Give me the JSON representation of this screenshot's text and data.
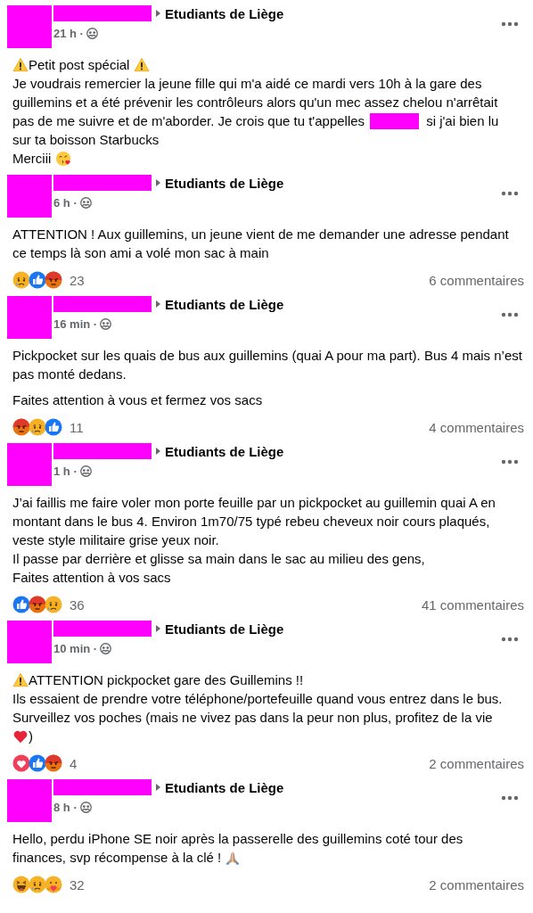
{
  "posts": [
    {
      "group": "Etudiants de Liège",
      "time": "21 h ·",
      "body": [
        [
          [
            {
              "kind": "warning"
            },
            {
              "kind": "text",
              "text": "Petit post spécial "
            },
            {
              "kind": "warning"
            }
          ],
          [
            {
              "kind": "text",
              "text": "Je voudrais remercier la jeune fille qui m'a aidé ce mardi vers 10h à la gare des"
            }
          ],
          [
            {
              "kind": "text",
              "text": "guillemins et a été prévenir les contrôleurs alors qu'un mec assez chelou n'arrêtait"
            }
          ],
          [
            {
              "kind": "text",
              "text": "pas de me suivre et de m'aborder. Je crois que tu t'appelles"
            },
            {
              "kind": "redaction"
            },
            {
              "kind": "text",
              "text": "si j'ai bien lu"
            }
          ],
          [
            {
              "kind": "text",
              "text": "sur ta boisson Starbucks"
            }
          ],
          [
            {
              "kind": "text",
              "text": "Merciii "
            },
            {
              "kind": "kiss"
            }
          ]
        ]
      ]
    },
    {
      "group": "Etudiants de Liège",
      "time": "6 h ·",
      "body": [
        [
          [
            {
              "kind": "text",
              "text": "ATTENTION ! Aux guillemins, un jeune vient de me demander une adresse pendant ce temps là son ami a volé mon sac à main"
            }
          ]
        ]
      ],
      "reactions": [
        {
          "kind": "sad"
        },
        {
          "kind": "like"
        },
        {
          "kind": "angry"
        }
      ],
      "count": "23",
      "comments": "6 commentaires"
    },
    {
      "group": "Etudiants de Liège",
      "time": "16 min ·",
      "body": [
        [
          [
            {
              "kind": "text",
              "text": "Pickpocket sur les quais de bus aux guillemins (quai A pour ma part). Bus 4 mais n’est pas monté dedans."
            }
          ]
        ],
        [
          [
            {
              "kind": "text",
              "text": "Faites attention à vous et fermez vos sacs"
            }
          ]
        ]
      ],
      "reactions": [
        {
          "kind": "angry"
        },
        {
          "kind": "sad"
        },
        {
          "kind": "like"
        }
      ],
      "count": "11",
      "comments": "4 commentaires"
    },
    {
      "group": "Etudiants de Liège",
      "time": "1 h ·",
      "body": [
        [
          [
            {
              "kind": "text",
              "text": "J’ai faillis me faire voler mon porte feuille par un pickpocket au guillemin quai A en montant dans le bus 4. Environ 1m70/75 typé rebeu cheveux noir cours plaqués, veste style militaire grise yeux noir."
            }
          ],
          [
            {
              "kind": "text",
              "text": "Il passe par derrière et glisse sa main dans le sac au milieu des gens,"
            }
          ],
          [
            {
              "kind": "text",
              "text": "Faites attention à vos sacs"
            }
          ]
        ]
      ],
      "reactions": [
        {
          "kind": "like"
        },
        {
          "kind": "angry"
        },
        {
          "kind": "sad"
        }
      ],
      "count": "36",
      "comments": "41 commentaires"
    },
    {
      "group": "Etudiants de Liège",
      "time": "10 min ·",
      "body": [
        [
          [
            {
              "kind": "warning"
            },
            {
              "kind": "text",
              "text": "ATTENTION pickpocket gare des Guillemins !!"
            }
          ],
          [
            {
              "kind": "text",
              "text": "Ils essaient de prendre votre téléphone/portefeuille quand vous entrez dans le bus."
            }
          ],
          [
            {
              "kind": "text",
              "text": "Surveillez vos poches (mais ne vivez pas dans la peur non plus, profitez de la vie"
            }
          ],
          [
            {
              "kind": "heart"
            },
            {
              "kind": "text",
              "text": ")"
            }
          ]
        ]
      ],
      "reactions": [
        {
          "kind": "love"
        },
        {
          "kind": "like"
        },
        {
          "kind": "angry"
        }
      ],
      "count": "4",
      "comments": "2 commentaires"
    },
    {
      "group": "Etudiants de Liège",
      "time": "8 h ·",
      "body": [
        [
          [
            {
              "kind": "text",
              "text": "Hello, perdu iPhone SE noir après la passerelle des guillemins coté tour des"
            }
          ],
          [
            {
              "kind": "text",
              "text": "finances, svp récompense à la clé ! "
            },
            {
              "kind": "pray"
            }
          ]
        ]
      ],
      "reactions": [
        {
          "kind": "haha"
        },
        {
          "kind": "sad"
        },
        {
          "kind": "care"
        }
      ],
      "count": "32",
      "comments": "2 commentaires"
    }
  ]
}
